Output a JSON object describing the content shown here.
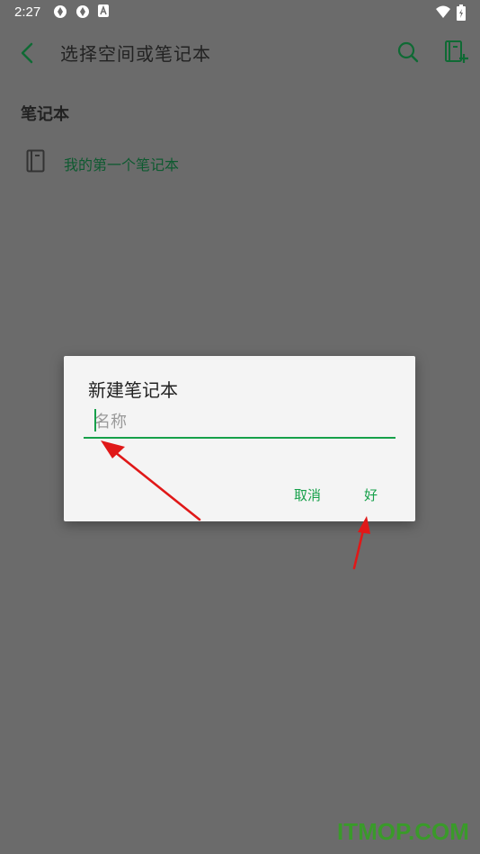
{
  "status_bar": {
    "time": "2:27",
    "icons": [
      "aperture-icon",
      "aperture-icon",
      "a-badge-icon",
      "wifi-icon",
      "battery-charging-icon"
    ]
  },
  "app_bar": {
    "title": "选择空间或笔记本",
    "back_icon": "chevron-left-icon",
    "search_icon": "search-icon",
    "new_notebook_icon": "add-notebook-icon"
  },
  "section": {
    "header": "笔记本",
    "items": [
      {
        "label": "我的第一个笔记本",
        "icon": "notebook-icon"
      }
    ]
  },
  "dialog": {
    "title": "新建笔记本",
    "input": {
      "placeholder": "名称",
      "value": ""
    },
    "cancel_label": "取消",
    "ok_label": "好"
  },
  "colors": {
    "accent": "#16a04a",
    "scrim": "#6b6b6b",
    "annotation_arrow": "#e01818"
  },
  "watermark": "ITMOP.COM"
}
